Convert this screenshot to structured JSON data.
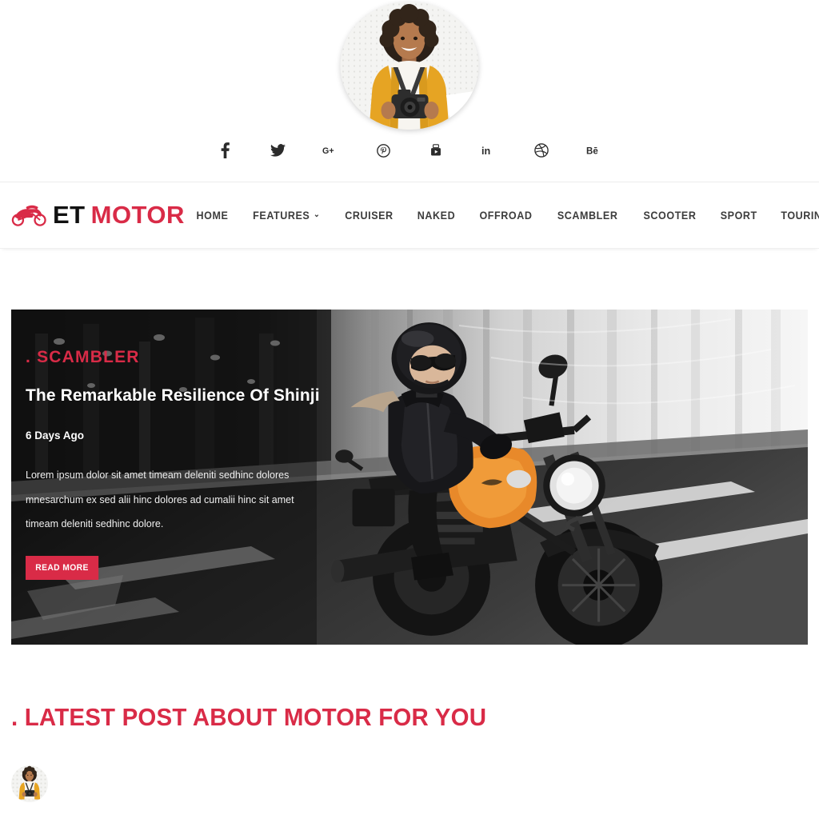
{
  "header": {
    "avatar_alt": "profile-photo-woman-with-camera",
    "socials": [
      {
        "name": "facebook-icon",
        "label": "f"
      },
      {
        "name": "twitter-icon",
        "label": "Twitter"
      },
      {
        "name": "google-plus-icon",
        "label": "G+"
      },
      {
        "name": "pinterest-icon",
        "label": "Pinterest"
      },
      {
        "name": "youtube-icon",
        "label": "YouTube"
      },
      {
        "name": "linkedin-icon",
        "label": "in"
      },
      {
        "name": "dribbble-icon",
        "label": "Dribbble"
      },
      {
        "name": "behance-icon",
        "label": "Be"
      }
    ]
  },
  "brand": {
    "part1": "ET",
    "part2": "MOTOR",
    "icon": "motorcycle-icon"
  },
  "nav": {
    "items": [
      {
        "label": "HOME",
        "has_caret": false
      },
      {
        "label": "FEATURES",
        "has_caret": true
      },
      {
        "label": "CRUISER",
        "has_caret": false
      },
      {
        "label": "NAKED",
        "has_caret": false
      },
      {
        "label": "OFFROAD",
        "has_caret": false
      },
      {
        "label": "SCAMBLER",
        "has_caret": false
      },
      {
        "label": "SCOOTER",
        "has_caret": false
      },
      {
        "label": "SPORT",
        "has_caret": false
      },
      {
        "label": "TOURING",
        "has_caret": false
      }
    ],
    "caret_glyph": "⌄",
    "menu_icon": "hamburger-menu-icon"
  },
  "hero": {
    "category": ". SCAMBLER",
    "title": "The Remarkable Resilience Of Shinji",
    "date": "6 Days Ago",
    "excerpt": "Lorem ipsum dolor sit amet timeam deleniti sedhinc dolores mnesarchum ex sed alii hinc dolores ad cumalii hinc sit amet timeam deleniti sedhinc dolore.",
    "cta_label": "READ MORE",
    "image_alt": "woman-riding-orange-motorcycle-on-road"
  },
  "latest": {
    "heading": ". LATEST POST ABOUT MOTOR FOR YOU",
    "post_avatar_alt": "author-avatar"
  },
  "colors": {
    "accent": "#D92B47",
    "text_dark": "#2b2b2b",
    "background": "#ffffff"
  }
}
